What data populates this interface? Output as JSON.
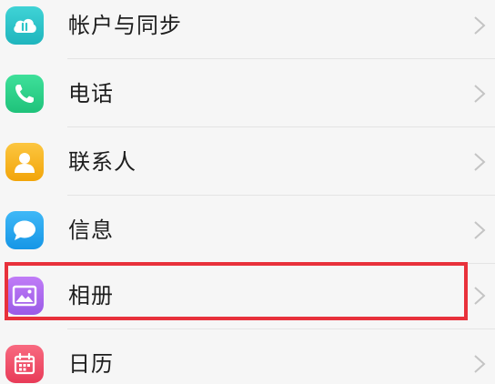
{
  "settings": {
    "items": [
      {
        "label": "帐户与同步",
        "icon": "cloud-sync-icon",
        "color": "#2ec5c9"
      },
      {
        "label": "电话",
        "icon": "phone-icon",
        "color": "#2ed48a"
      },
      {
        "label": "联系人",
        "icon": "contact-person-icon",
        "color": "#f7b621"
      },
      {
        "label": "信息",
        "icon": "message-bubble-icon",
        "color": "#27a6f0"
      },
      {
        "label": "相册",
        "icon": "photo-album-icon",
        "color": "#b070f0"
      },
      {
        "label": "日历",
        "icon": "calendar-icon",
        "color": "#f0506a"
      }
    ]
  },
  "highlight": {
    "color": "#e8313b",
    "target": "相册"
  }
}
